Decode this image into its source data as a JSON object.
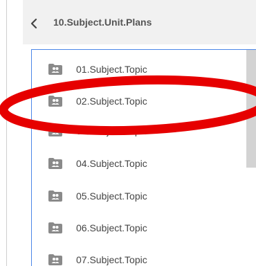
{
  "header": {
    "back_icon": "chevron-left-icon",
    "title": "10.Subject.Unit.Plans"
  },
  "folder_list": {
    "item_icon": "shared-folder-icon",
    "items": [
      {
        "label": "01.Subject.Topic"
      },
      {
        "label": "02.Subject.Topic"
      },
      {
        "label": "03.Subject.Topic"
      },
      {
        "label": "04.Subject.Topic"
      },
      {
        "label": "05.Subject.Topic"
      },
      {
        "label": "06.Subject.Topic"
      },
      {
        "label": "07.Subject.Topic"
      }
    ]
  },
  "colors": {
    "header_bg": "#f1f1f1",
    "focus_border": "#4a86e8",
    "folder_icon": "#8a8a8a",
    "annotation": "#e60000"
  }
}
